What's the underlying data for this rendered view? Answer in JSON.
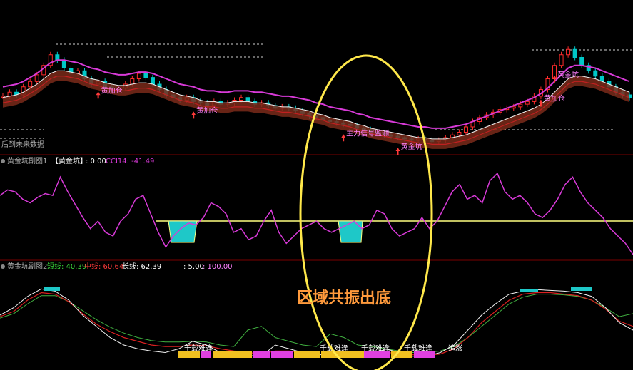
{
  "colors": {
    "background": "#000000",
    "divider": "#7a0000",
    "up_candle": "#ff2b2b",
    "down_candle": "#00c8c8",
    "magenta_line": "#d83ad8",
    "white_line": "#f0f0f0",
    "red_line": "#d82020",
    "green_line": "#40b040",
    "yellow_line": "#ffff80",
    "highlight_ellipse": "#ffe84a",
    "annotation_text": "#ff9a3c",
    "cyan_box": "#1ec8c8",
    "label_grey": "#b0b0b0",
    "label_white": "#ffffff",
    "label_green": "#3ad83a",
    "label_red": "#ff3a3a",
    "label_magenta": "#ff40ff",
    "label_pink": "#ff80ff",
    "gold_bar": "#f0c020",
    "pink_bar": "#e040e0"
  },
  "main_panel": {
    "no_data_text": "后到未来数据",
    "signal_labels": [
      {
        "text": "黄加仓",
        "icon": "arrow-up-icon"
      },
      {
        "text": "黄加仓",
        "icon": "arrow-up-icon"
      },
      {
        "text": "主力信号监测",
        "icon": "arrow-up-icon"
      },
      {
        "text": "黄金坑",
        "icon": "arrow-up-icon"
      },
      {
        "text": "黄加仓",
        "icon": "arrow-up-icon"
      },
      {
        "text": "黄金坑",
        "icon": "arrow-up-icon"
      }
    ]
  },
  "panel1": {
    "title": "黄金坑副图1",
    "legend_name": "【黄金坑】",
    "legend_value": ": 0.00",
    "cci_label": "CCI14: -41.49"
  },
  "panel2": {
    "title": "黄金坑副图2",
    "short_label": "短线: 40.39",
    "mid_label": "中线: 60.64",
    "long_label": "长线: 62.39",
    "level_1": ": 5.00",
    "level_2": ": 100.00",
    "bottom_labels": [
      "千载难逢",
      "千载难逢",
      "千载难逢",
      "千载难逢",
      "追涨"
    ]
  },
  "annotation": {
    "text": "区域共振出底"
  },
  "chart_data": [
    {
      "type": "candlestick",
      "panel": "main",
      "close": [
        49,
        52,
        50,
        56,
        60,
        65,
        72,
        80,
        76,
        70,
        66,
        68,
        62,
        58,
        60,
        56,
        54,
        55,
        58,
        62,
        66,
        63,
        58,
        54,
        50,
        48,
        46,
        48,
        45,
        44,
        42,
        45,
        43,
        44,
        46,
        48,
        45,
        43,
        44,
        42,
        40,
        41,
        40,
        38,
        36,
        34,
        33,
        31,
        30,
        29,
        28,
        27,
        25,
        24,
        22,
        21,
        20,
        19,
        18,
        17,
        16,
        17,
        16,
        15,
        16,
        18,
        20,
        22,
        26,
        30,
        33,
        35,
        37,
        39,
        40,
        41,
        43,
        45,
        49,
        54,
        62,
        72,
        80,
        84,
        78,
        72,
        68,
        64,
        60,
        56,
        52,
        50,
        48
      ],
      "moving_average": [
        48,
        49,
        50,
        52,
        55,
        58,
        62,
        66,
        68,
        68,
        67,
        66,
        64,
        62,
        61,
        59,
        58,
        57,
        57,
        58,
        59,
        59,
        58,
        56,
        54,
        52,
        50,
        49,
        48,
        46,
        45,
        45,
        44,
        44,
        45,
        45,
        45,
        44,
        44,
        43,
        42,
        41,
        41,
        40,
        39,
        38,
        36,
        35,
        33,
        32,
        31,
        30,
        28,
        27,
        25,
        24,
        23,
        22,
        21,
        20,
        19,
        18,
        18,
        17,
        17,
        17,
        18,
        19,
        20,
        22,
        24,
        26,
        28,
        30,
        32,
        34,
        36,
        38,
        40,
        43,
        47,
        52,
        57,
        62,
        64,
        64,
        63,
        62,
        60,
        58,
        56,
        54,
        52
      ]
    },
    {
      "type": "line",
      "panel": "panel1",
      "series": [
        {
          "name": "CCI14",
          "values": [
            30,
            45,
            40,
            20,
            10,
            25,
            35,
            30,
            80,
            40,
            5,
            -30,
            -60,
            -40,
            -70,
            -80,
            -40,
            -20,
            20,
            30,
            -20,
            -70,
            -110,
            -80,
            -60,
            -45,
            -50,
            -30,
            10,
            0,
            -20,
            -70,
            -60,
            -90,
            -80,
            -40,
            -10,
            -70,
            -100,
            -80,
            -60,
            -50,
            -40,
            -60,
            -70,
            -60,
            -50,
            -40,
            -60,
            -50,
            -10,
            -20,
            -60,
            -80,
            -70,
            -60,
            -30,
            -60,
            -40,
            0,
            40,
            60,
            20,
            30,
            10,
            70,
            90,
            40,
            20,
            30,
            10,
            -20,
            -30,
            -10,
            20,
            60,
            80,
            40,
            10,
            -10,
            -30,
            -60,
            -80,
            -100,
            -130
          ]
        },
        {
          "name": "【黄金坑】",
          "values": [
            0.0
          ]
        }
      ],
      "reference_line": -45
    },
    {
      "type": "line",
      "panel": "panel2",
      "series": [
        {
          "name": "短线",
          "values": [
            60,
            70,
            85,
            95,
            92,
            80,
            60,
            45,
            30,
            20,
            15,
            12,
            10,
            15,
            25,
            20,
            10,
            8,
            6,
            5,
            20,
            15,
            10,
            8,
            5,
            6,
            8,
            5,
            15,
            10,
            5,
            5,
            10,
            20,
            40,
            60,
            75,
            88,
            92,
            94,
            93,
            92,
            90,
            85,
            70,
            50,
            40
          ]
        },
        {
          "name": "中线",
          "values": [
            58,
            65,
            80,
            90,
            88,
            78,
            62,
            48,
            38,
            30,
            25,
            20,
            18,
            18,
            20,
            19,
            15,
            12,
            10,
            8,
            12,
            12,
            10,
            8,
            7,
            7,
            8,
            7,
            10,
            9,
            7,
            6,
            8,
            15,
            30,
            50,
            65,
            80,
            88,
            90,
            90,
            88,
            86,
            80,
            68,
            52,
            45
          ]
        },
        {
          "name": "长线",
          "values": [
            56,
            62,
            75,
            86,
            86,
            78,
            66,
            54,
            44,
            36,
            30,
            26,
            24,
            24,
            25,
            24,
            20,
            18,
            40,
            45,
            30,
            25,
            20,
            18,
            35,
            30,
            20,
            18,
            15,
            12,
            10,
            10,
            12,
            18,
            30,
            45,
            60,
            75,
            84,
            88,
            88,
            87,
            85,
            80,
            70,
            58,
            62
          ]
        }
      ],
      "levels": [
        5.0,
        100.0
      ]
    }
  ]
}
